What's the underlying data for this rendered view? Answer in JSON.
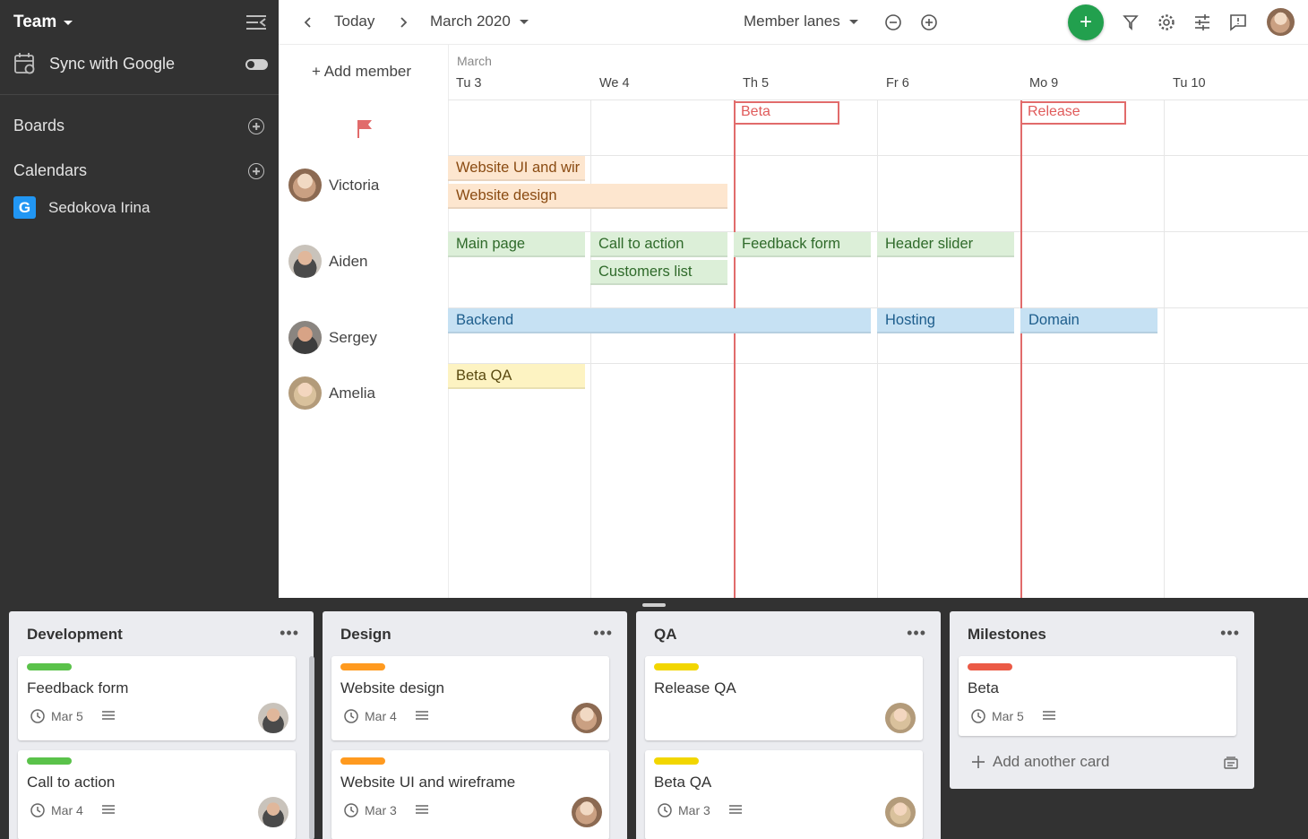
{
  "sidebar": {
    "team": "Team",
    "sync": "Sync with Google",
    "boards": "Boards",
    "calendars": "Calendars",
    "calendar_item": {
      "badge": "G",
      "name": "Sedokova Irina"
    }
  },
  "topbar": {
    "today": "Today",
    "month": "March 2020",
    "view": "Member lanes"
  },
  "calendar": {
    "add_member": "+ Add member",
    "month_label": "March",
    "days": [
      "Tu 3",
      "We 4",
      "Th 5",
      "Fr 6",
      "Mo 9",
      "Tu 10"
    ],
    "milestones": [
      "Beta",
      "Release"
    ],
    "members": [
      "Victoria",
      "Aiden",
      "Sergey",
      "Amelia"
    ],
    "tasks": {
      "victoria": [
        "Website UI and wir",
        "Website design"
      ],
      "aiden": [
        "Main page",
        "Call to action",
        "Customers list",
        "Feedback form",
        "Header slider"
      ],
      "sergey": [
        "Backend",
        "Hosting",
        "Domain"
      ],
      "amelia": [
        "Beta QA"
      ]
    }
  },
  "board": {
    "columns": [
      {
        "title": "Development",
        "cards": [
          {
            "title": "Feedback form",
            "date": "Mar 5",
            "label_color": "#5ac24a"
          },
          {
            "title": "Call to action",
            "date": "Mar 4",
            "label_color": "#5ac24a"
          }
        ]
      },
      {
        "title": "Design",
        "cards": [
          {
            "title": "Website design",
            "date": "Mar 4",
            "label_color": "#ff9a1f"
          },
          {
            "title": "Website UI and wireframe",
            "date": "Mar 3",
            "label_color": "#ff9a1f"
          }
        ]
      },
      {
        "title": "QA",
        "cards": [
          {
            "title": "Release QA",
            "date": "",
            "label_color": "#f2d600"
          },
          {
            "title": "Beta QA",
            "date": "Mar 3",
            "label_color": "#f2d600"
          }
        ]
      },
      {
        "title": "Milestones",
        "cards": [
          {
            "title": "Beta",
            "date": "Mar 5",
            "label_color": "#eb5a46"
          }
        ],
        "add_card": "Add another card"
      }
    ]
  },
  "colors": {
    "sidebar_bg": "#323232",
    "accent_green": "#22a04e",
    "milestone_red": "#e16b6b"
  }
}
